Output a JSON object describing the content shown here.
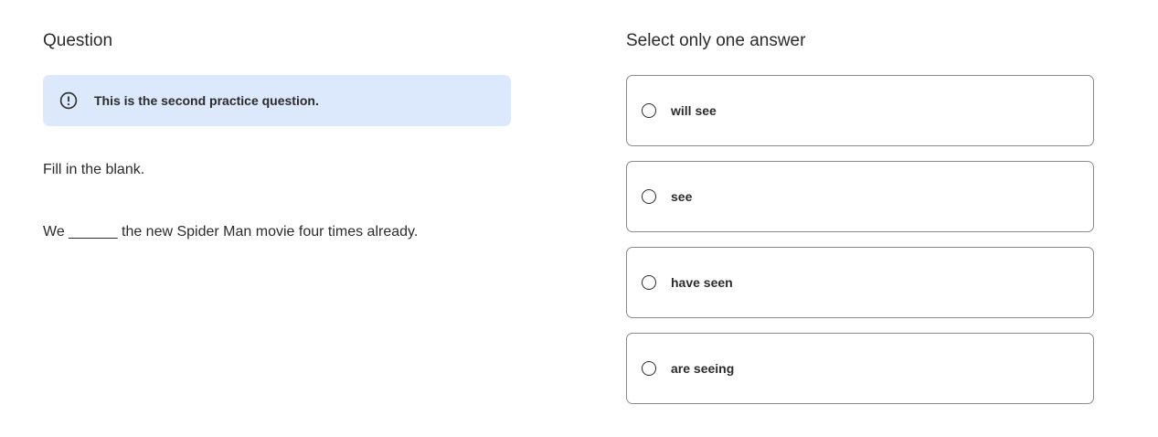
{
  "question_panel": {
    "heading": "Question",
    "notice": {
      "icon": "exclamation-circle-icon",
      "text": "This is the second practice question."
    },
    "instruction": "Fill in the blank.",
    "sentence": "We ______ the new Spider Man movie four times already."
  },
  "answer_panel": {
    "heading": "Select only one answer",
    "options": [
      {
        "label": "will see",
        "selected": false
      },
      {
        "label": "see",
        "selected": false
      },
      {
        "label": "have seen",
        "selected": false
      },
      {
        "label": "are seeing",
        "selected": false
      }
    ]
  },
  "colors": {
    "banner_background": "#dce8fc",
    "card_border": "#8a8a8a",
    "text": "#2b2b2b"
  }
}
